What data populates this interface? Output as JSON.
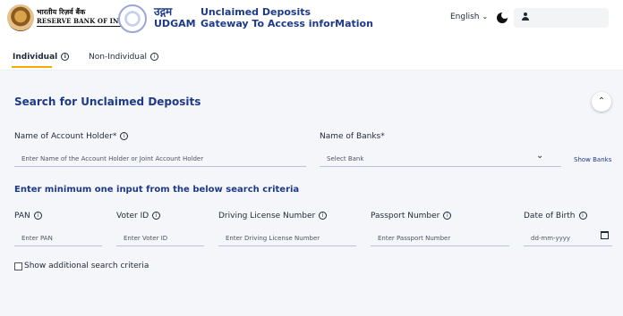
{
  "header": {
    "rbi_hindi": "भारतीय रिज़र्व बैंक",
    "rbi_english": "RESERVE BANK OF INDIA",
    "udgam_hindi": "उद्गम",
    "udgam_english": "UDGAM",
    "title_line1": "Unclaimed Deposits",
    "title_line2": "Gateway To Access inforMation",
    "language": "English",
    "icons": {
      "language": "chevron-down-icon",
      "theme": "moon-icon",
      "user": "user-icon"
    }
  },
  "tabs": [
    {
      "label": "Individual",
      "active": true
    },
    {
      "label": "Non-Individual",
      "active": false
    }
  ],
  "accent_colors": {
    "primary": "#1d3a8a",
    "tab_underline": "#f2a900"
  },
  "search": {
    "title": "Search for Unclaimed Deposits",
    "account_holder_label": "Name of Account Holder*",
    "account_holder_placeholder": "Enter Name of the Account Holder or Joint Account Holder",
    "banks_label": "Name of Banks*",
    "banks_placeholder": "Select Bank",
    "show_banks": "Show Banks",
    "criteria_title": "Enter minimum one input from the below search criteria",
    "criteria": [
      {
        "label": "PAN",
        "placeholder": "Enter PAN"
      },
      {
        "label": "Voter ID",
        "placeholder": "Enter Voter ID"
      },
      {
        "label": "Driving License Number",
        "placeholder": "Enter Driving License Number"
      },
      {
        "label": "Passport Number",
        "placeholder": "Enter Passport Number"
      },
      {
        "label": "Date of Birth",
        "placeholder": "dd-mm-yyyy"
      }
    ],
    "additional_label": "Show additional search criteria"
  }
}
